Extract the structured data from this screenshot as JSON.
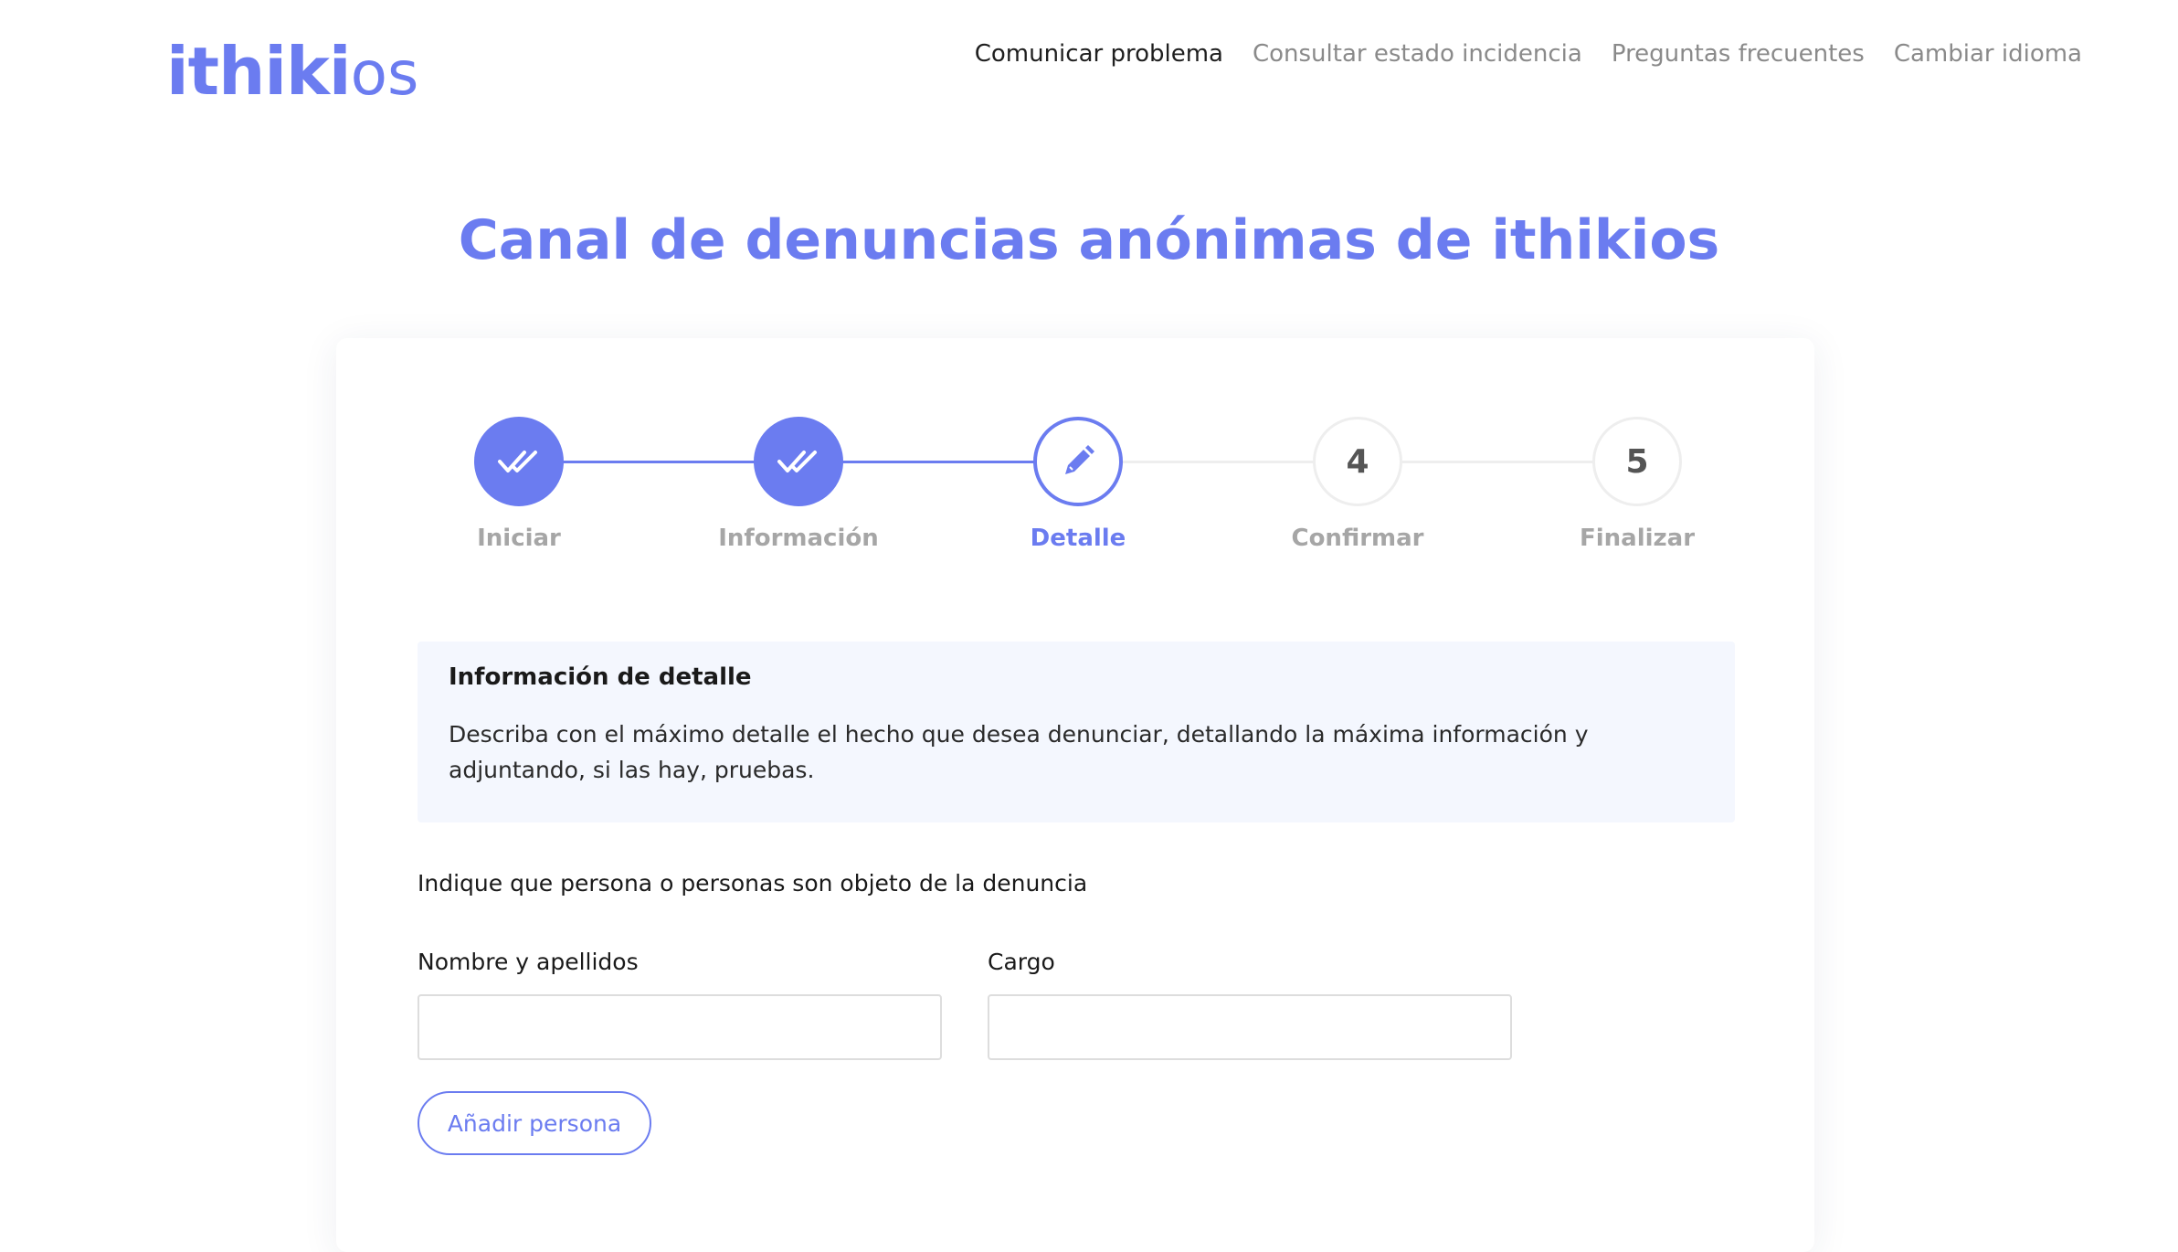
{
  "header": {
    "logo": {
      "bold": "ithiki",
      "light": "os"
    },
    "nav": [
      {
        "label": "Comunicar problema",
        "active": true
      },
      {
        "label": "Consultar estado incidencia",
        "active": false
      },
      {
        "label": "Preguntas frecuentes",
        "active": false
      },
      {
        "label": "Cambiar idioma",
        "active": false
      }
    ]
  },
  "page": {
    "title": "Canal de denuncias anónimas de ithikios"
  },
  "stepper": {
    "steps": [
      {
        "label": "Iniciar",
        "state": "done",
        "icon": "double-check-icon"
      },
      {
        "label": "Información",
        "state": "done",
        "icon": "double-check-icon"
      },
      {
        "label": "Detalle",
        "state": "current",
        "icon": "pencil-icon"
      },
      {
        "label": "Confirmar",
        "state": "pending",
        "number": "4"
      },
      {
        "label": "Finalizar",
        "state": "pending",
        "number": "5"
      }
    ]
  },
  "info": {
    "title": "Información de detalle",
    "text": "Describa con el máximo detalle el hecho que desea denunciar, detallando la máxima información y adjuntando, si las hay, pruebas."
  },
  "form": {
    "heading": "Indique que persona o personas son objeto de la denuncia",
    "name_label": "Nombre y apellidos",
    "name_value": "",
    "role_label": "Cargo",
    "role_value": "",
    "add_button": "Añadir persona"
  },
  "colors": {
    "accent": "#6b7cf0",
    "info_bg": "#f4f7fe",
    "muted": "#a6a6a6"
  }
}
